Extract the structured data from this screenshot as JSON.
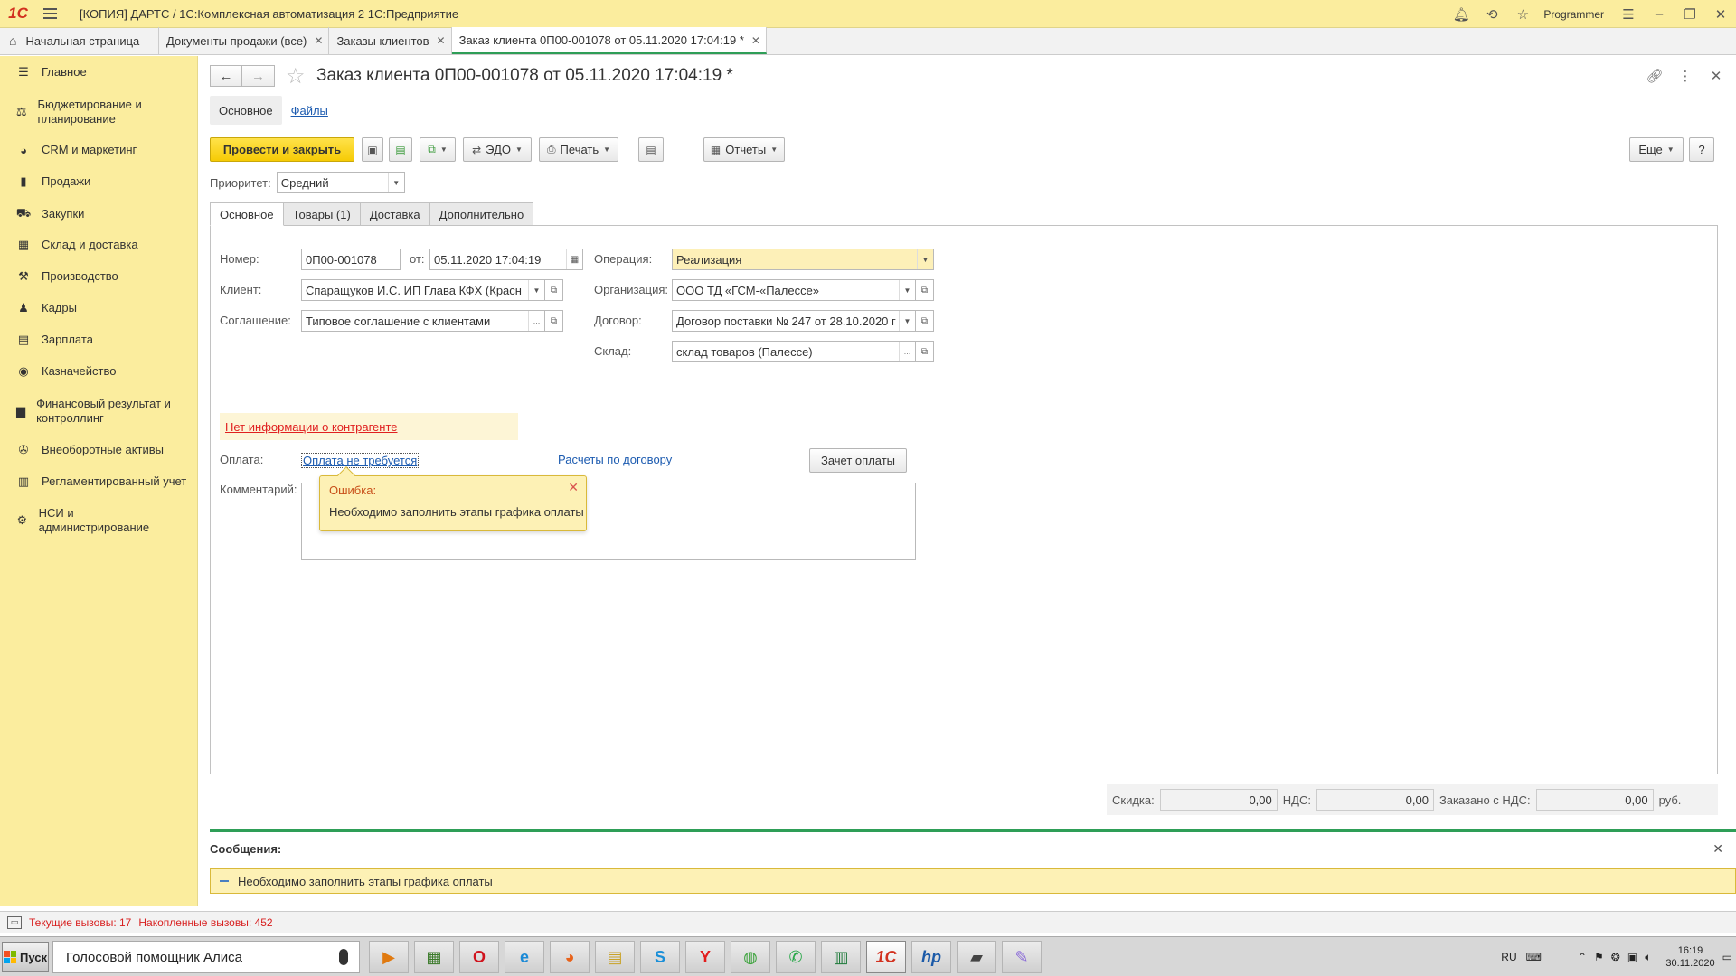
{
  "window": {
    "logo": "1С",
    "title": "[КОПИЯ] ДАРТС / 1С:Комплексная автоматизация 2 1С:Предприятие",
    "user": "Programmer"
  },
  "tabs": {
    "home": "Начальная страница",
    "items": [
      {
        "label": "Документы продажи (все)"
      },
      {
        "label": "Заказы клиентов"
      },
      {
        "label": "Заказ клиента 0П00-001078 от 05.11.2020 17:04:19 *"
      }
    ]
  },
  "sidebar": {
    "items": [
      {
        "label": "Главное",
        "icon": "☰"
      },
      {
        "label": "Бюджетирование и планирование",
        "icon": "⚖"
      },
      {
        "label": "CRM и маркетинг",
        "icon": "◕"
      },
      {
        "label": "Продажи",
        "icon": "▮"
      },
      {
        "label": "Закупки",
        "icon": "⛟"
      },
      {
        "label": "Склад и доставка",
        "icon": "▦"
      },
      {
        "label": "Производство",
        "icon": "⚒"
      },
      {
        "label": "Кадры",
        "icon": "♟"
      },
      {
        "label": "Зарплата",
        "icon": "▤"
      },
      {
        "label": "Казначейство",
        "icon": "◉"
      },
      {
        "label": "Финансовый результат и контроллинг",
        "icon": "▆"
      },
      {
        "label": "Внеоборотные активы",
        "icon": "✇"
      },
      {
        "label": "Регламентированный учет",
        "icon": "▥"
      },
      {
        "label": "НСИ и администрирование",
        "icon": "⚙"
      }
    ]
  },
  "document": {
    "title": "Заказ клиента 0П00-001078 от 05.11.2020 17:04:19 *",
    "section_tabs": {
      "main": "Основное",
      "files": "Файлы"
    }
  },
  "toolbar": {
    "post_close": "Провести и закрыть",
    "edo": "ЭДО",
    "print": "Печать",
    "reports": "Отчеты",
    "more": "Еще",
    "help": "?"
  },
  "priority": {
    "label": "Приоритет:",
    "value": "Средний"
  },
  "form_tabs": [
    "Основное",
    "Товары (1)",
    "Доставка",
    "Дополнительно"
  ],
  "form": {
    "number_label": "Номер:",
    "number": "0П00-001078",
    "date_label": "от:",
    "date": "05.11.2020 17:04:19",
    "operation_label": "Операция:",
    "operation": "Реализация",
    "client_label": "Клиент:",
    "client": "Спаращуков И.С. ИП Глава КФХ (Красн",
    "org_label": "Организация:",
    "org": "ООО ТД «ГСМ-«Палессе»",
    "agreement_label": "Соглашение:",
    "agreement": "Типовое соглашение с клиентами",
    "contract_label": "Договор:",
    "contract": "Договор поставки № 247 от 28.10.2020 г",
    "warehouse_label": "Склад:",
    "warehouse": "склад товаров (Палессе)",
    "no_info": "Нет информации о контрагенте",
    "payment_label": "Оплата:",
    "payment_link": "Оплата не требуется",
    "contract_calc_link": "Расчеты по договору",
    "offset_button": "Зачет оплаты",
    "comment_label": "Комментарий:"
  },
  "tooltip": {
    "title": "Ошибка:",
    "text": "Необходимо заполнить этапы графика оплаты"
  },
  "totals": {
    "discount_label": "Скидка:",
    "discount": "0,00",
    "vat_label": "НДС:",
    "vat": "0,00",
    "ordered_label": "Заказано с НДС:",
    "ordered": "0,00",
    "currency": "руб."
  },
  "messages": {
    "title": "Сообщения:",
    "items": [
      {
        "text": "Необходимо заполнить этапы графика оплаты"
      }
    ]
  },
  "statusbar": {
    "current_calls": "Текущие вызовы: 17",
    "accum_calls": "Накопленные вызовы: 452"
  },
  "taskbar": {
    "start": "Пуск",
    "alice": "Голосовой помощник Алиса",
    "lang": "RU",
    "time": "16:19",
    "date": "30.11.2020"
  },
  "colors": {
    "accent_yellow": "#fbed9e",
    "primary_button": "#f6cb05",
    "active_tab_underline": "#2e9e57",
    "error_text": "#e02020"
  }
}
